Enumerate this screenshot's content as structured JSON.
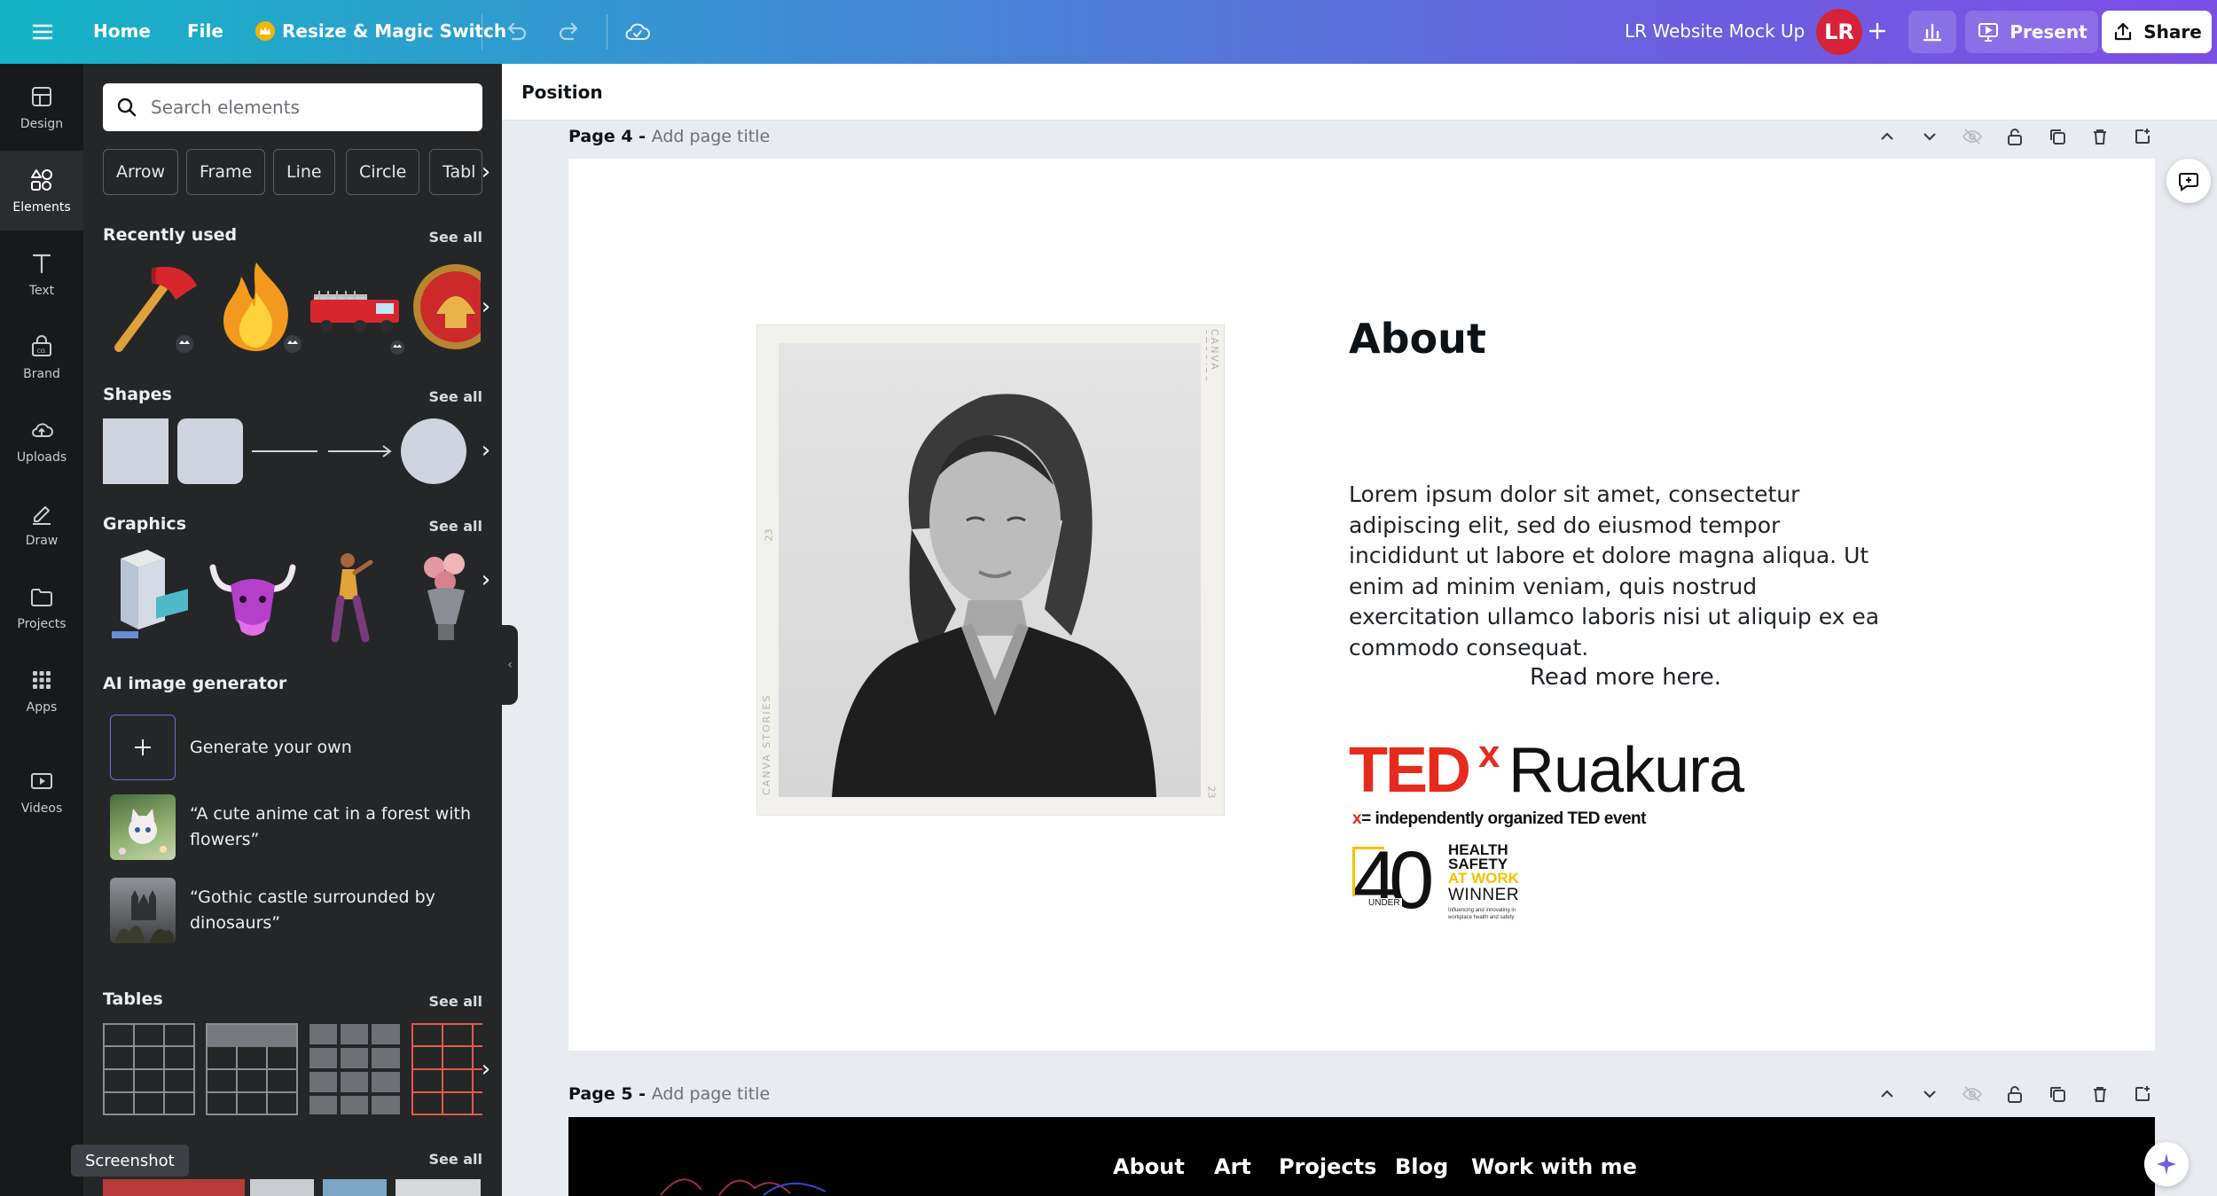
{
  "topbar": {
    "home": "Home",
    "file": "File",
    "resize": "Resize & Magic Switch",
    "doc_title": "LR Website Mock Up",
    "avatar_initials": "LR",
    "present": "Present",
    "share": "Share"
  },
  "rail": {
    "items": [
      {
        "label": "Design",
        "icon": "layout-icon"
      },
      {
        "label": "Elements",
        "icon": "shapes-icon"
      },
      {
        "label": "Text",
        "icon": "text-icon"
      },
      {
        "label": "Brand",
        "icon": "brand-icon"
      },
      {
        "label": "Uploads",
        "icon": "upload-cloud-icon"
      },
      {
        "label": "Draw",
        "icon": "pen-icon"
      },
      {
        "label": "Projects",
        "icon": "folder-icon"
      },
      {
        "label": "Apps",
        "icon": "apps-grid-icon"
      },
      {
        "label": "Videos",
        "icon": "video-icon"
      }
    ]
  },
  "panel": {
    "search_placeholder": "Search elements",
    "chips": [
      "Arrow",
      "Frame",
      "Line",
      "Circle",
      "Tabl"
    ],
    "recently_used": "Recently used",
    "shapes": "Shapes",
    "graphics": "Graphics",
    "ai_generator": "AI image generator",
    "generate_own": "Generate your own",
    "ai_prompt_1": "“A cute anime cat in a forest with flowers”",
    "ai_prompt_2": "“Gothic castle surrounded by dinosaurs”",
    "tables": "Tables",
    "see_all": "See all",
    "tooltip": "Screenshot"
  },
  "canvas": {
    "position": "Position",
    "page4_num": "Page 4 - ",
    "page5_num": "Page 5 - ",
    "add_title": "Add page title",
    "about_heading": "About",
    "about_body": "Lorem ipsum dolor sit amet, consectetur adipiscing elit, sed do eiusmod tempor incididunt ut labore et dolore magna aliqua. Ut enim ad minim veniam, quis nostrud exercitation ullamco laboris nisi ut aliquip ex ea commodo consequat.",
    "read_more": "Read more here.",
    "tedx_ted": "TED",
    "tedx_x": "x",
    "tedx_name": "Ruakura",
    "tedx_tagline_x": "x",
    "tedx_tagline": "= independently organized TED event",
    "award_number": "40",
    "award_under": "UNDER",
    "award_line1": "HEALTH",
    "award_line2": "SAFETY",
    "award_line3": "AT WORK",
    "award_winner": "WINNER",
    "award_small": "Influencing and innovating in workplace health and safety",
    "photo_edge_text": "CANVA STORIES",
    "photo_edge_num": "23",
    "page5_nav": [
      "About",
      "Art",
      "Projects",
      "Blog",
      "Work with me"
    ]
  },
  "colors": {
    "ted_red": "#e62b1e",
    "rail_bg": "#18191b",
    "panel_bg": "#252627",
    "accent_purple": "#7b4ee6",
    "award_yellow": "#f2c200"
  }
}
